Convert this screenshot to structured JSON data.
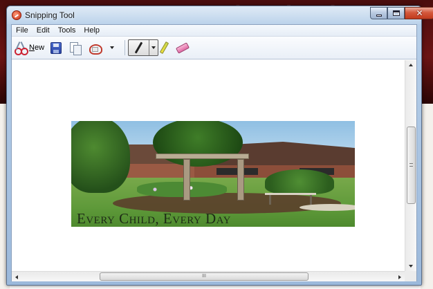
{
  "window": {
    "title": "Snipping Tool"
  },
  "menu": {
    "items": [
      "File",
      "Edit",
      "Tools",
      "Help"
    ]
  },
  "toolbar": {
    "new_underlined": "N",
    "new_rest": "ew"
  },
  "snip": {
    "caption": "Every Child, Every Day"
  },
  "scrollbars": {
    "h_grip": "III",
    "v_grip": "≡"
  },
  "colors": {
    "title_bar": "#b9d1ea",
    "close_button": "#c13a1d",
    "page_banner": "#6b1414"
  }
}
